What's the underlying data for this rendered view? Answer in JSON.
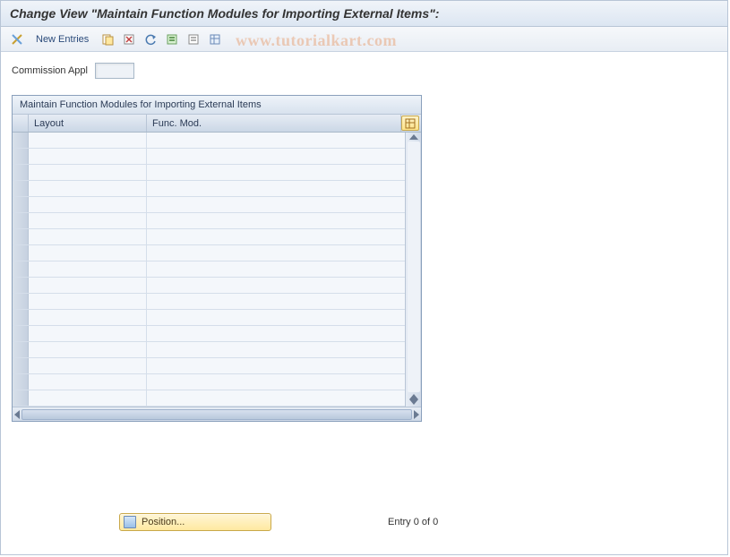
{
  "title": "Change View \"Maintain Function Modules for Importing External Items\":",
  "watermark": "www.tutorialkart.com",
  "toolbar": {
    "new_entries_label": "New Entries"
  },
  "fields": {
    "commission_appl_label": "Commission Appl",
    "commission_appl_value": ""
  },
  "table": {
    "title": "Maintain Function Modules for Importing External Items",
    "columns": {
      "layout": "Layout",
      "func_mod": "Func. Mod."
    },
    "row_count": 17
  },
  "footer": {
    "position_label": "Position...",
    "entry_text": "Entry 0 of 0"
  }
}
